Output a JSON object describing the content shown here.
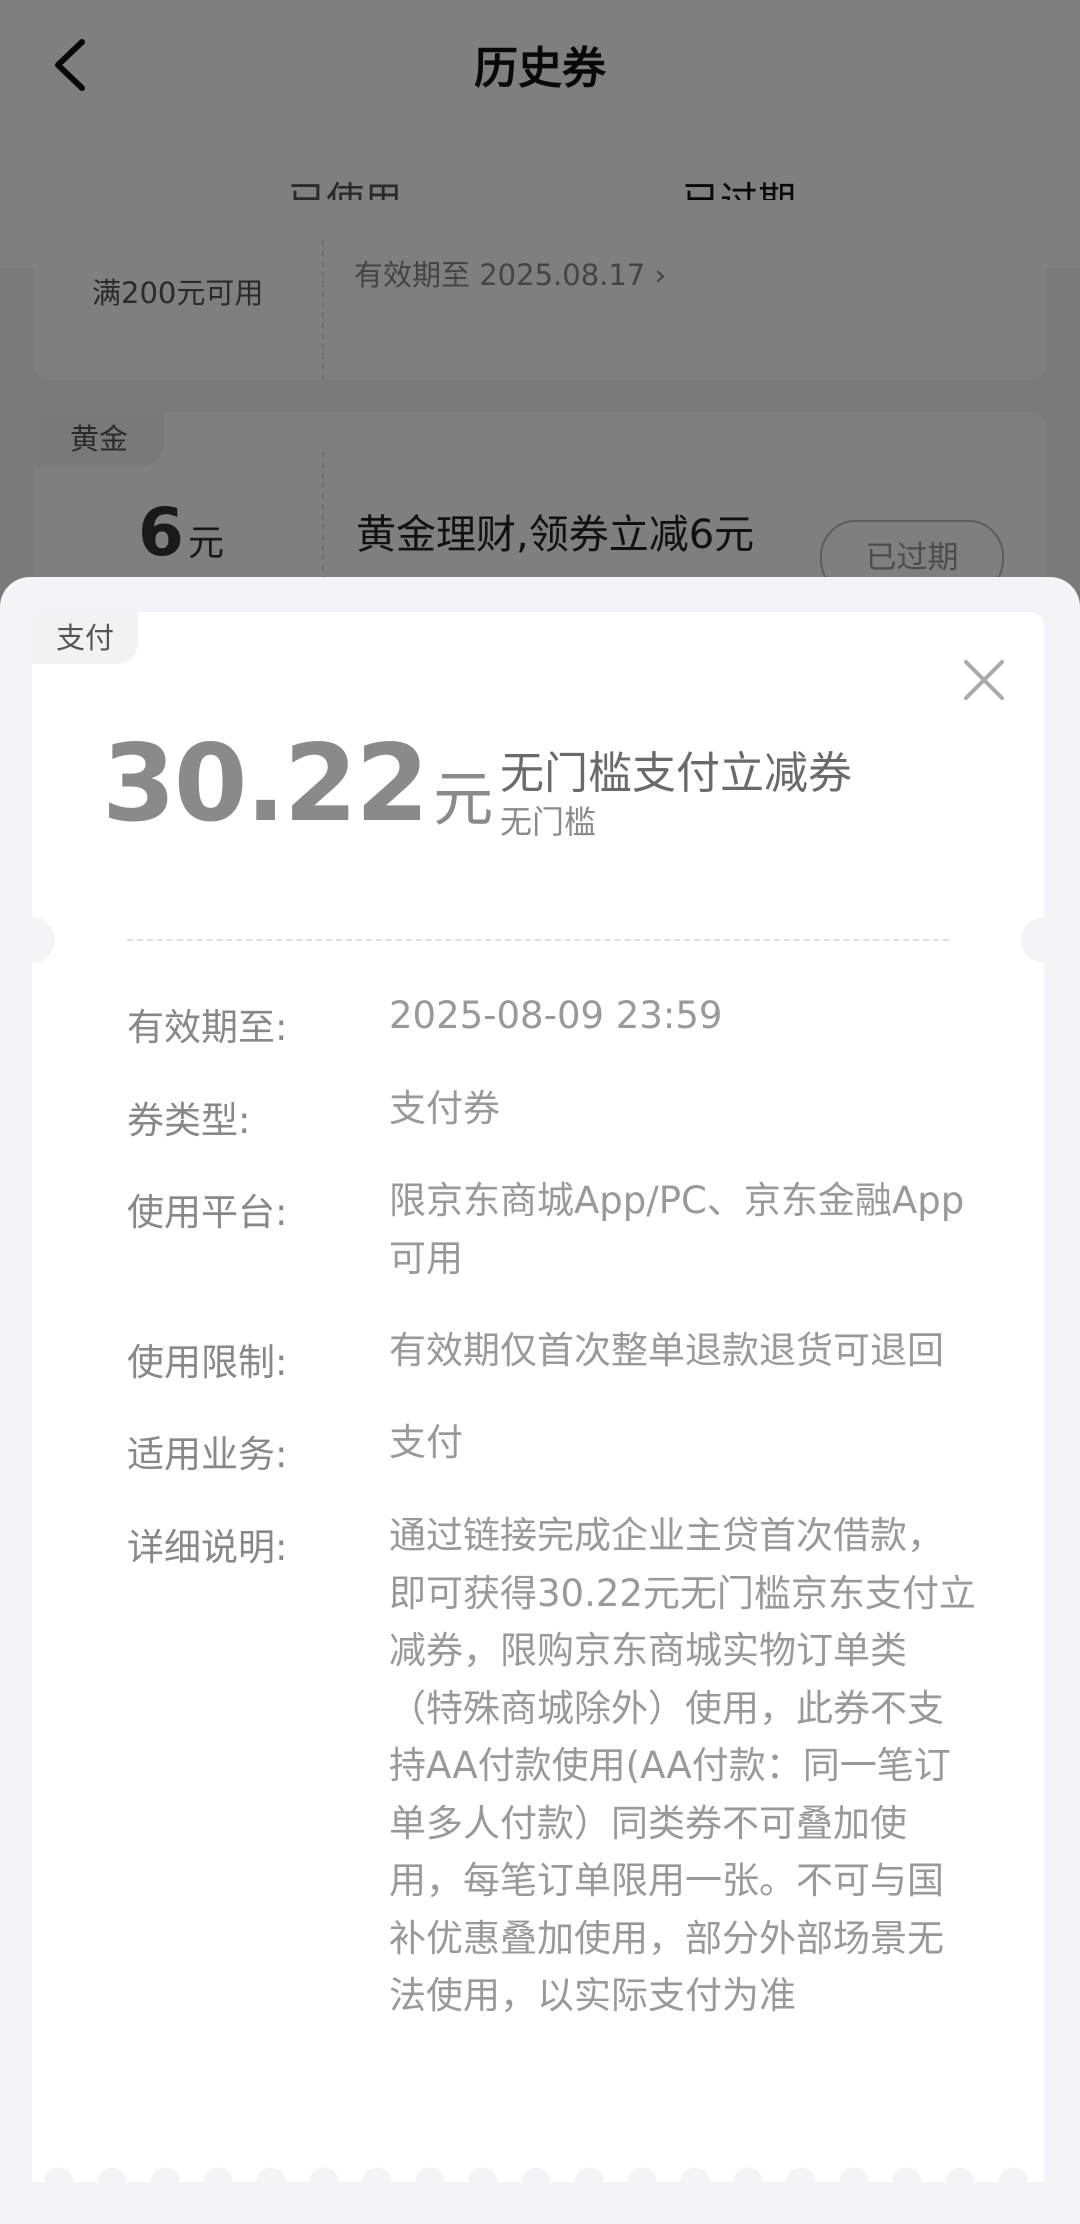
{
  "header": {
    "title": "历史券",
    "tabs": [
      {
        "label": "已使用",
        "active": false
      },
      {
        "label": "已过期",
        "active": true
      }
    ],
    "accent_color": "#e21b2b"
  },
  "background_list": {
    "card1": {
      "condition": "满200元可用",
      "validity": "有效期至 2025.08.17"
    },
    "card2": {
      "tag": "黄金",
      "amount": "6",
      "unit": "元",
      "name": "黄金理财,领券立减6元",
      "status": "已过期"
    }
  },
  "sheet": {
    "tag": "支付",
    "amount": "30.22",
    "unit": "元",
    "title": "无门槛支付立减券",
    "subtitle": "无门槛",
    "close_icon": "close-icon",
    "details": [
      {
        "label": "有效期至:",
        "value": "2025-08-09 23:59"
      },
      {
        "label": "券类型:",
        "value": "支付券"
      },
      {
        "label": "使用平台:",
        "value": "限京东商城App/PC、京东金融App可用"
      },
      {
        "label": "使用限制:",
        "value": "有效期仅首次整单退款退货可退回"
      },
      {
        "label": "适用业务:",
        "value": "支付"
      },
      {
        "label": "详细说明:",
        "value": "通过链接完成企业主贷首次借款，即可获得30.22元无门槛京东支付立减券，限购京东商城实物订单类（特殊商城除外）使用，此券不支持AA付款使用(AA付款：同一笔订单多人付款）同类券不可叠加使用，每笔订单限用一张。不可与国补优惠叠加使用，部分外部场景无法使用，以实际支付为准"
      }
    ]
  }
}
